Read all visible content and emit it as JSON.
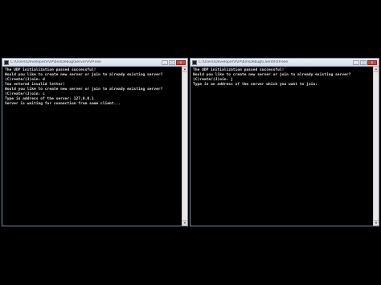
{
  "windows": {
    "left": {
      "title": "C:\\Users\\Developer\\P2P\\bin\\Debug\\Server\\P2P.exe",
      "lines": [
        "The UDP initialization passed successful!",
        "Would you like to create new server or join to already existing server?",
        "(C)reate/(J)oin: d",
        "You entered invalid letter!",
        "Would you like to create new server or join to already existing server?",
        "(C)reate/(J)oin: c",
        "Type in address of the server: 127.0.0.1",
        "Server is waiting for connection from some client..."
      ]
    },
    "right": {
      "title": "C:\\Users\\Developer\\P2P\\bin\\Debug\\Client\\P2P.exe",
      "lines": [
        "The UDP initialization passed successful!",
        "Would you like to create new server or join to already existing server?",
        "(C)reate/(J)oin: j",
        "Type in an address of the server which you want to join:"
      ]
    }
  },
  "controls": {
    "minimize": "_",
    "maximize": "□",
    "close": "x"
  }
}
